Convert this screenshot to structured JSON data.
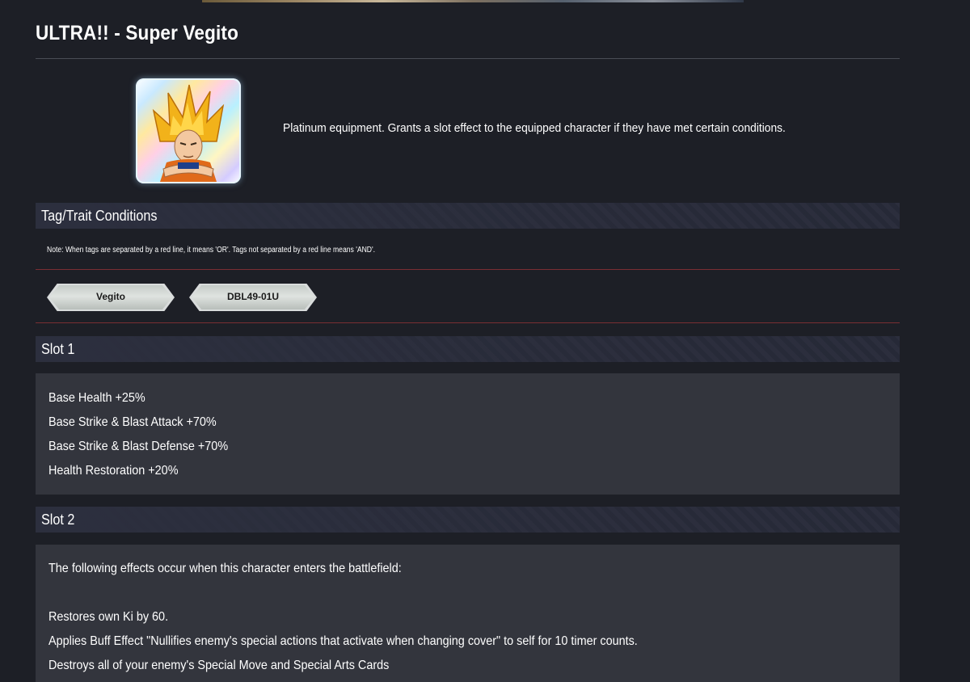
{
  "page": {
    "title": "ULTRA!! - Super Vegito",
    "description": "Platinum equipment. Grants a slot effect to the equipped character if they have met certain conditions."
  },
  "conditions": {
    "heading": "Tag/Trait Conditions",
    "note": "Note: When tags are separated by a red line, it means 'OR'. Tags not separated by a red line means 'AND'.",
    "tags": [
      "Vegito",
      "DBL49-01U"
    ]
  },
  "slot1": {
    "heading": "Slot 1",
    "lines": [
      "Base Health +25%",
      "Base Strike & Blast Attack +70%",
      "Base Strike & Blast Defense +70%",
      "Health Restoration +20%"
    ]
  },
  "slot2": {
    "heading": "Slot 2",
    "intro": "The following effects occur when this character enters the battlefield:",
    "lines": [
      "Restores own Ki by 60.",
      "Applies Buff Effect \"Nullifies enemy's special actions that activate when changing cover\" to self for 10 timer counts.",
      "Destroys all of your enemy's Special Move and Special Arts Cards"
    ]
  },
  "icons": {
    "equipment": "super-vegito-equipment-icon"
  },
  "colors": {
    "background": "#1d1f26",
    "panel": "#33353d",
    "separator_red": "#7a2e33"
  }
}
